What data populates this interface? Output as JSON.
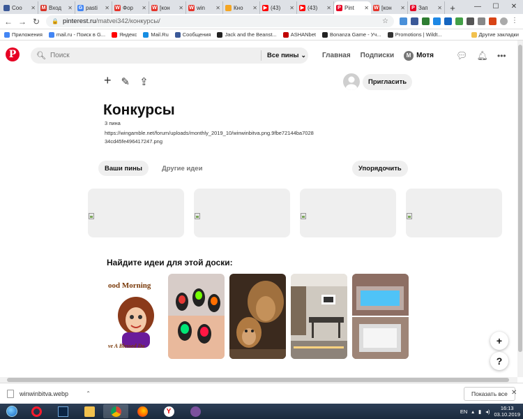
{
  "browser": {
    "tabs": [
      {
        "title": "Соо",
        "favicon_color": "#3b5998",
        "favicon_letter": "",
        "active": false
      },
      {
        "title": "Вход",
        "favicon_color": "#d93025",
        "favicon_letter": "M",
        "active": false
      },
      {
        "title": "pasti",
        "favicon_color": "#4285f4",
        "favicon_letter": "G",
        "active": false
      },
      {
        "title": "Фор",
        "favicon_color": "#e6332a",
        "favicon_letter": "W",
        "active": false
      },
      {
        "title": "[кон",
        "favicon_color": "#e6332a",
        "favicon_letter": "W",
        "active": false
      },
      {
        "title": "win",
        "favicon_color": "#e6332a",
        "favicon_letter": "W",
        "active": false
      },
      {
        "title": "Кно",
        "favicon_color": "#f5a623",
        "favicon_letter": "",
        "active": false
      },
      {
        "title": "(43)",
        "favicon_color": "#ff0000",
        "favicon_letter": "▶",
        "active": false
      },
      {
        "title": "(43)",
        "favicon_color": "#ff0000",
        "favicon_letter": "▶",
        "active": false
      },
      {
        "title": "Pint",
        "favicon_color": "#e60023",
        "favicon_letter": "P",
        "active": true
      },
      {
        "title": "[кон",
        "favicon_color": "#e6332a",
        "favicon_letter": "W",
        "active": false
      },
      {
        "title": "Зап",
        "favicon_color": "#e60023",
        "favicon_letter": "P",
        "active": false
      }
    ],
    "new_tab_symbol": "+",
    "url_host": "pinterest.ru",
    "url_path": "/matvei342/конкурсы/",
    "bookmarks": [
      {
        "label": "Приложения",
        "color": "#4285f4"
      },
      {
        "label": "mail.ru - Поиск в G...",
        "color": "#4285f4"
      },
      {
        "label": "Яндекс",
        "color": "#ff0000"
      },
      {
        "label": "Mail.Ru",
        "color": "#168de2"
      },
      {
        "label": "Сообщения",
        "color": "#3b5998"
      },
      {
        "label": "Jack and the Beanst...",
        "color": "#222222"
      },
      {
        "label": "ASHANbet",
        "color": "#c00000"
      },
      {
        "label": "Bonanza Game - Уч...",
        "color": "#222222"
      },
      {
        "label": "Promotions | Wildt...",
        "color": "#333333"
      }
    ],
    "other_bookmarks": "Другие закладки"
  },
  "pinterest": {
    "search_placeholder": "Поиск",
    "search_filter": "Все пины",
    "nav_home": "Главная",
    "nav_following": "Подписки",
    "user_initial": "M",
    "user_name": "Мотя",
    "invite_label": "Пригласить",
    "board_title": "Конкурсы",
    "pin_count": "3 пина",
    "board_description": "https://wingamble.net/forum/uploads/monthly_2019_10/winwinbitva.png.9fbe72144ba702834cd45fe496417247.png",
    "tab_your_pins": "Ваши пины",
    "tab_more_ideas": "Другие идеи",
    "sort_label": "Упорядочить",
    "ideas_title": "Найдите идеи для этой доски:",
    "fab_plus": "+",
    "fab_help": "?"
  },
  "download": {
    "file_name": "winwinbitva.webp",
    "show_all": "Показать все"
  },
  "taskbar": {
    "lang": "EN",
    "time": "16:13",
    "date": "03.10.2019"
  }
}
